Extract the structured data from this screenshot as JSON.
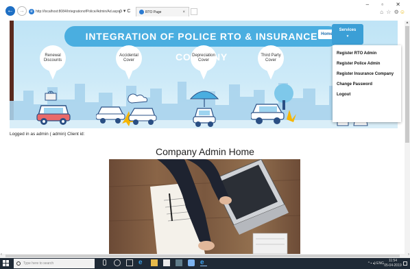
{
  "browser": {
    "address": "http://localhost:8084/IntegrationofPolice/Admin/Ad.aspx",
    "tab_title": "RTO Page",
    "tab_close": "×",
    "address_icons": "ρ ▾ C",
    "window_controls": "– ▫ ✕",
    "toolbar_icons": "⌂ ☆ ⚙"
  },
  "banner": {
    "title": "INTEGRATION OF POLICE RTO & INSURANCE COMPANY",
    "nav": {
      "home": "Home",
      "services": "Services",
      "services_caret": "▾"
    },
    "bubbles": [
      "Renewal Discounts",
      "Accidental Cover",
      "Depreciation Cover",
      "Third Party Cover"
    ]
  },
  "dropdown": {
    "items": [
      "Register RTO Admin",
      "Register Police Admin",
      "Register Insurance Company",
      "Change Password",
      "Logout"
    ]
  },
  "page": {
    "logged_in": "Logged in as admin ( admin) Client id:",
    "heading": "Company Admin Home"
  },
  "taskbar": {
    "search_placeholder": "Type here to search",
    "tray_text": "^ ▪ ◂) ENG",
    "time": "11:54",
    "date": "05-04-2019"
  },
  "colors": {
    "title_pill": "#4aaee0",
    "services_btn": "#3b9fd6",
    "taskbar": "#1f2a36",
    "sky": "#cdeaf8"
  }
}
